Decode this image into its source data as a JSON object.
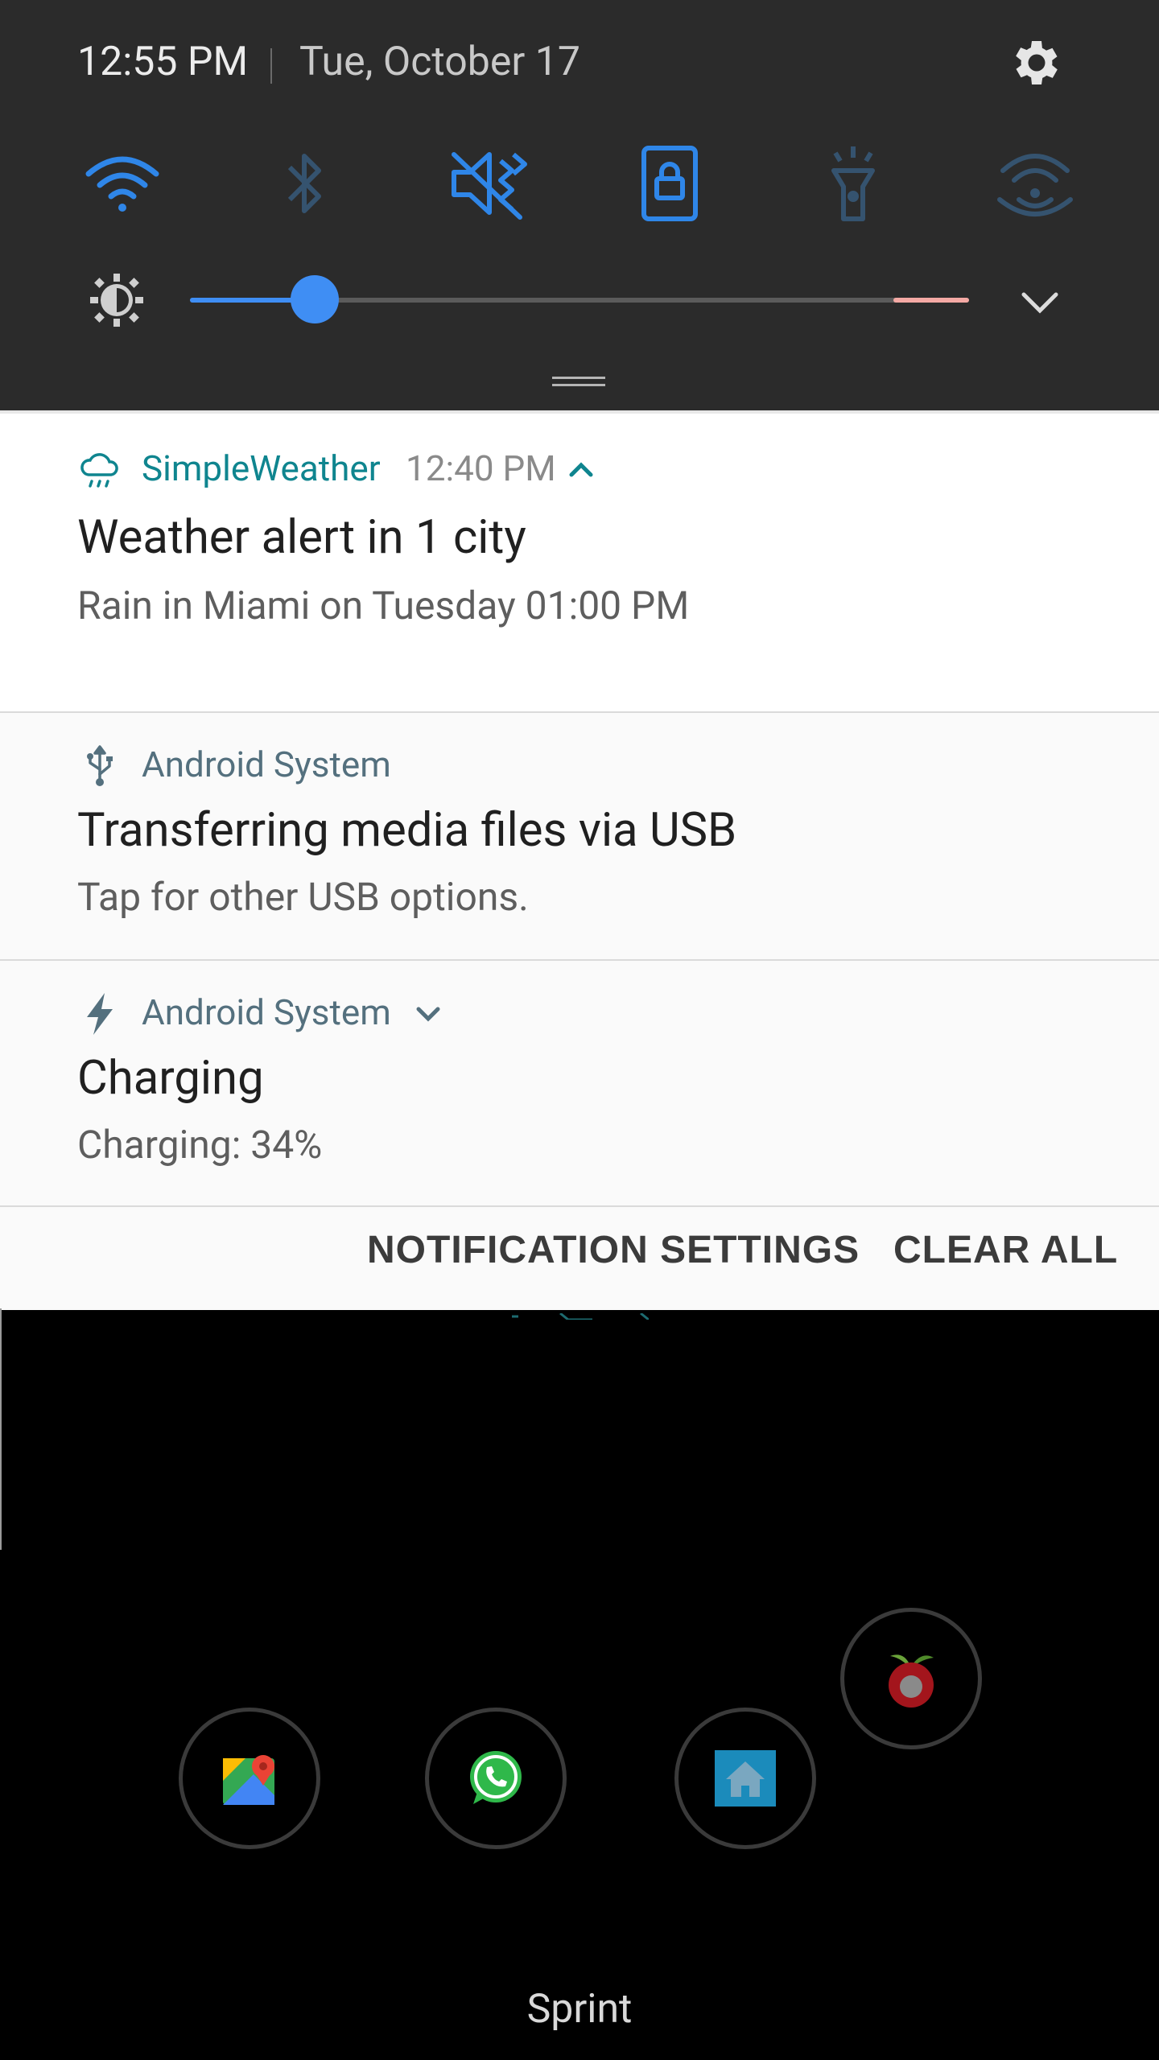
{
  "status": {
    "time": "12:55 PM",
    "date": "Tue, October 17"
  },
  "quick_settings": {
    "tiles": [
      {
        "icon": "wifi-icon",
        "state": "on"
      },
      {
        "icon": "bluetooth-icon",
        "state": "off"
      },
      {
        "icon": "sound-mute-icon",
        "state": "on"
      },
      {
        "icon": "screen-rotation-lock-icon",
        "state": "on"
      },
      {
        "icon": "flashlight-icon",
        "state": "off"
      },
      {
        "icon": "mobile-hotspot-icon",
        "state": "off"
      }
    ],
    "brightness_fraction": 0.16,
    "accent_color": "#3f8ef4"
  },
  "notifications": [
    {
      "app": "SimpleWeather",
      "time": "12:40 PM",
      "title": "Weather alert in 1 city",
      "text": "Rain in Miami on Tuesday 01:00 PM",
      "app_color": "#0f858f"
    },
    {
      "app": "Android System",
      "title": "Transferring media files via USB",
      "text": "Tap for other USB options.",
      "app_color": "#54707e"
    },
    {
      "app": "Android System",
      "title": "Charging",
      "text": "Charging: 34%",
      "app_color": "#54707e"
    }
  ],
  "actions": {
    "settings_label": "NOTIFICATION SETTINGS",
    "clear_label": "CLEAR ALL"
  },
  "home": {
    "dock": [
      "maps-icon",
      "whatsapp-icon",
      "home-app-icon",
      "pi-hole-icon"
    ],
    "carrier": "Sprint"
  }
}
